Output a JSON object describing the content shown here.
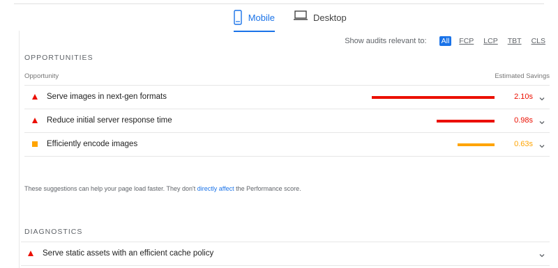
{
  "tabs": [
    {
      "label": "Mobile",
      "icon": "phone-icon",
      "active": true
    },
    {
      "label": "Desktop",
      "icon": "laptop-icon",
      "active": false
    }
  ],
  "filter": {
    "label": "Show audits relevant to:",
    "chips": [
      "All",
      "FCP",
      "LCP",
      "TBT",
      "CLS"
    ],
    "active": "All"
  },
  "opportunities": {
    "title": "OPPORTUNITIES",
    "column_left": "Opportunity",
    "column_right": "Estimated Savings",
    "items": [
      {
        "title": "Serve images in next-gen formats",
        "savings": "2.10s",
        "savings_fraction": 1.0,
        "status": "fail",
        "color": "#eb0f00"
      },
      {
        "title": "Reduce initial server response time",
        "savings": "0.98s",
        "savings_fraction": 0.47,
        "status": "fail",
        "color": "#eb0f00"
      },
      {
        "title": "Efficiently encode images",
        "savings": "0.63s",
        "savings_fraction": 0.3,
        "status": "average",
        "color": "#ffa400"
      }
    ]
  },
  "note": {
    "before": "These suggestions can help your page load faster. They don't ",
    "link": "directly affect",
    "after": " the Performance score."
  },
  "diagnostics": {
    "title": "DIAGNOSTICS",
    "items": [
      {
        "title": "Serve static assets with an efficient cache policy",
        "status": "fail"
      }
    ]
  },
  "colors": {
    "accent": "#1a73e8",
    "fail": "#eb0f00",
    "average": "#ffa400"
  }
}
